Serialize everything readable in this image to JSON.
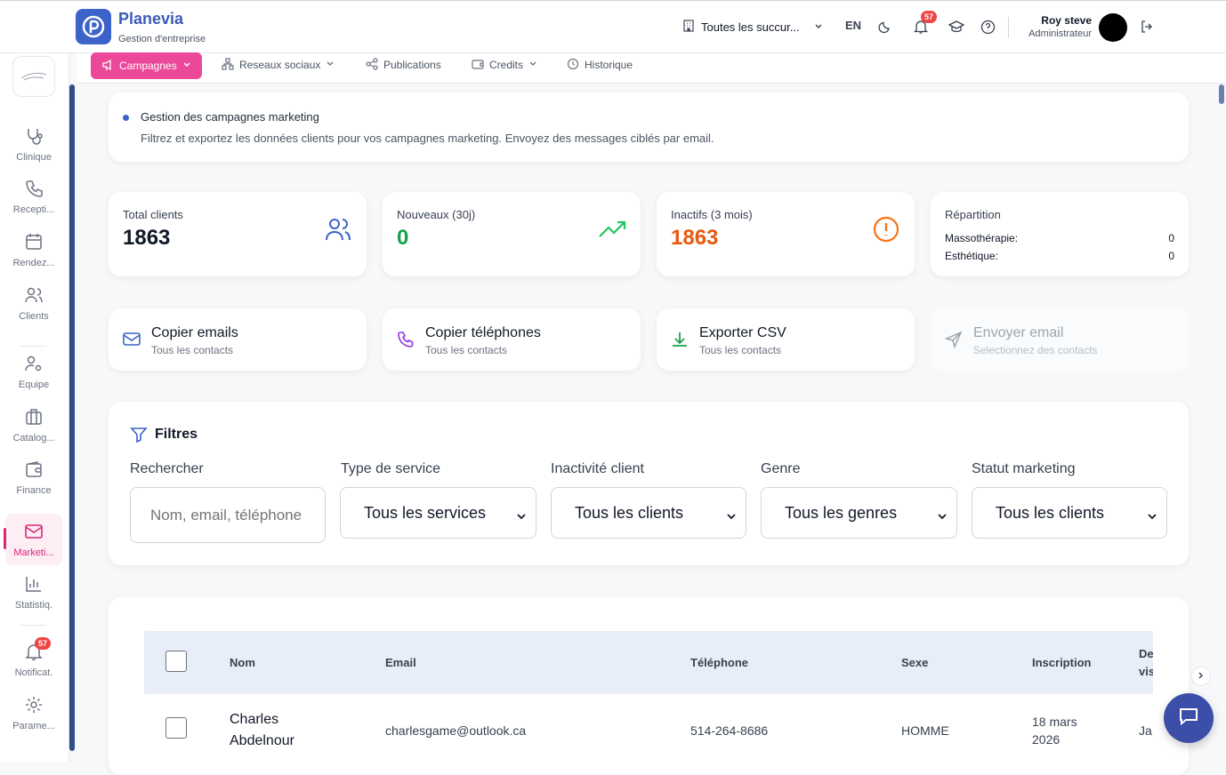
{
  "app": {
    "name": "Planevia",
    "subtitle": "Gestion d'entreprise"
  },
  "topbar": {
    "branch": "Toutes les succur...",
    "language": "EN",
    "notification_count": "57",
    "user_name": "Roy steve",
    "user_role": "Administrateur"
  },
  "sidebar": {
    "items": [
      {
        "label": "Clinique",
        "icon": "stethoscope-icon"
      },
      {
        "label": "Recepti...",
        "icon": "phone-icon"
      },
      {
        "label": "Rendez...",
        "icon": "calendar-icon"
      },
      {
        "label": "Clients",
        "icon": "users-icon"
      },
      {
        "label": "Equipe",
        "icon": "user-cog-icon"
      },
      {
        "label": "Catalog...",
        "icon": "briefcase-icon"
      },
      {
        "label": "Finance",
        "icon": "wallet-icon"
      },
      {
        "label": "Marketi...",
        "icon": "mail-icon"
      },
      {
        "label": "Statistiq.",
        "icon": "bar-chart-icon"
      },
      {
        "label": "Notificat.",
        "icon": "bell-icon"
      },
      {
        "label": "Parame...",
        "icon": "gear-icon"
      }
    ],
    "notif_badge": "57"
  },
  "tabs": [
    {
      "label": "Campagnes"
    },
    {
      "label": "Reseaux sociaux"
    },
    {
      "label": "Publications"
    },
    {
      "label": "Credits"
    },
    {
      "label": "Historique"
    }
  ],
  "info": {
    "title": "Gestion des campagnes marketing",
    "description": "Filtrez et exportez les données clients pour vos campagnes marketing. Envoyez des messages ciblés par email."
  },
  "stats": {
    "total": {
      "label": "Total clients",
      "value": "1863"
    },
    "new": {
      "label": "Nouveaux (30j)",
      "value": "0",
      "color": "#16a34a"
    },
    "inactive": {
      "label": "Inactifs (3 mois)",
      "value": "1863",
      "color": "#ea580c"
    },
    "breakdown": {
      "label": "Répartition",
      "rows": [
        {
          "name": "Massothérapie:",
          "value": "0"
        },
        {
          "name": "Esthétique:",
          "value": "0"
        }
      ]
    }
  },
  "actions": [
    {
      "title": "Copier emails",
      "sub": "Tous les contacts"
    },
    {
      "title": "Copier téléphones",
      "sub": "Tous les contacts"
    },
    {
      "title": "Exporter CSV",
      "sub": "Tous les contacts"
    },
    {
      "title": "Envoyer email",
      "sub": "Selectionnez des contacts"
    }
  ],
  "filters": {
    "title": "Filtres",
    "search": {
      "label": "Rechercher",
      "placeholder": "Nom, email, téléphone"
    },
    "service": {
      "label": "Type de service",
      "value": "Tous les services"
    },
    "inactivity": {
      "label": "Inactivité client",
      "value": "Tous les clients"
    },
    "gender": {
      "label": "Genre",
      "value": "Tous les genres"
    },
    "marketing": {
      "label": "Statut marketing",
      "value": "Tous les clients"
    }
  },
  "table": {
    "headers": [
      "Nom",
      "Email",
      "Téléphone",
      "Sexe",
      "Inscription",
      "De",
      "vis"
    ],
    "rows": [
      {
        "name_first": "Charles",
        "name_last": "Abdelnour",
        "email": "charlesgame@outlook.ca",
        "phone": "514-264-8686",
        "sex": "HOMME",
        "date_1": "18 mars",
        "date_2": "2026",
        "last": "Ja"
      }
    ]
  },
  "colors": {
    "accent": "#ec4899",
    "brand": "#3b63c9"
  }
}
